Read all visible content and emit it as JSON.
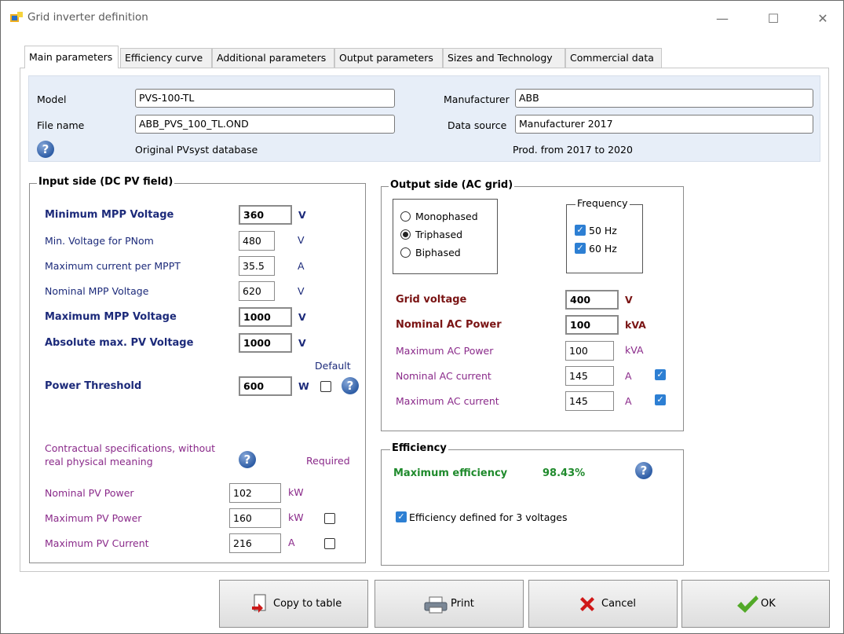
{
  "window": {
    "title": "Grid inverter definition",
    "minimize": "—",
    "maximize": "☐",
    "close": "✕"
  },
  "tabs": [
    {
      "label": "Main parameters"
    },
    {
      "label": "Efficiency curve"
    },
    {
      "label": "Additional parameters"
    },
    {
      "label": "Output parameters"
    },
    {
      "label": "Sizes and Technology"
    },
    {
      "label": "Commercial data"
    }
  ],
  "header": {
    "model_label": "Model",
    "model_value": "PVS-100-TL",
    "manufacturer_label": "Manufacturer",
    "manufacturer_value": "ABB",
    "filename_label": "File name",
    "filename_value": "ABB_PVS_100_TL.OND",
    "datasource_label": "Data source",
    "datasource_value": "Manufacturer 2017",
    "database_note": "Original PVsyst database",
    "production_note": "Prod. from 2017 to 2020"
  },
  "input_side": {
    "title": "Input side (DC PV field)",
    "rows": [
      {
        "label": "Minimum MPP Voltage",
        "value": "360",
        "unit": "V"
      },
      {
        "label": "Min. Voltage for PNom",
        "value": "480",
        "unit": "V"
      },
      {
        "label": "Maximum current per MPPT",
        "value": "35.5",
        "unit": "A"
      },
      {
        "label": "Nominal MPP Voltage",
        "value": "620",
        "unit": "V"
      },
      {
        "label": "Maximum MPP Voltage",
        "value": "1000",
        "unit": "V"
      },
      {
        "label": "Absolute max. PV Voltage",
        "value": "1000",
        "unit": "V"
      },
      {
        "label": "Power Threshold",
        "value": "600",
        "unit": "W"
      }
    ],
    "default_label": "Default",
    "contract_note": "Contractual specifications, without real physical meaning",
    "required_label": "Required",
    "contract_rows": [
      {
        "label": "Nominal PV Power",
        "value": "102",
        "unit": "kW"
      },
      {
        "label": "Maximum PV Power",
        "value": "160",
        "unit": "kW"
      },
      {
        "label": "Maximum PV Current",
        "value": "216",
        "unit": "A"
      }
    ]
  },
  "output_side": {
    "title": "Output side (AC grid)",
    "phases": [
      {
        "label": "Monophased",
        "selected": false
      },
      {
        "label": "Triphased",
        "selected": true
      },
      {
        "label": "Biphased",
        "selected": false
      }
    ],
    "frequency_title": "Frequency",
    "frequencies": [
      {
        "label": "50 Hz",
        "checked": true
      },
      {
        "label": "60 Hz",
        "checked": true
      }
    ],
    "rows": [
      {
        "label": "Grid voltage",
        "value": "400",
        "unit": "V"
      },
      {
        "label": "Nominal AC Power",
        "value": "100",
        "unit": "kVA"
      },
      {
        "label": "Maximum AC Power",
        "value": "100",
        "unit": "kVA"
      },
      {
        "label": "Nominal AC current",
        "value": "145",
        "unit": "A"
      },
      {
        "label": "Maximum AC current",
        "value": "145",
        "unit": "A"
      }
    ]
  },
  "efficiency": {
    "title": "Efficiency",
    "max_label": "Maximum efficiency",
    "max_value": "98.43%",
    "three_voltages_label": "Efficiency defined for 3 voltages"
  },
  "buttons": {
    "copy": "Copy to table",
    "print": "Print",
    "cancel": "Cancel",
    "ok": "OK"
  },
  "help_glyph": "?",
  "check_glyph": "✓"
}
